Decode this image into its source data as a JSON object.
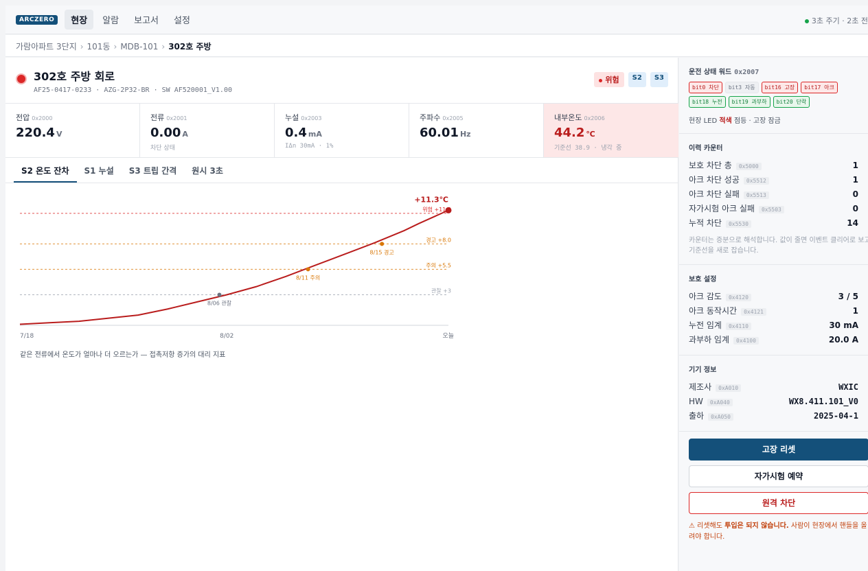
{
  "app": {
    "brand": "ARCZERO",
    "nav": [
      "현장",
      "알람",
      "보고서",
      "설정"
    ],
    "cycle_text": "3초 주기 · 2초 전"
  },
  "breadcrumb": [
    "가람아파트 3단지",
    "101동",
    "MDB-101",
    "302호 주방"
  ],
  "circuit": {
    "title": "302호 주방 회로",
    "subtitle": "AF25-0417-0233 · AZG-2P32-BR · SW AF520001_V1.00",
    "status_badge": "위험",
    "tags": [
      "S2",
      "S3"
    ]
  },
  "metrics": [
    {
      "label": "전압",
      "addr": "0x2000",
      "value": "220.4",
      "unit": "V",
      "note": ""
    },
    {
      "label": "전류",
      "addr": "0x2001",
      "value": "0.00",
      "unit": "A",
      "note": "차단 상태"
    },
    {
      "label": "누설",
      "addr": "0x2003",
      "value": "0.4",
      "unit": "mA",
      "note": "IΔn 30mA · 1%"
    },
    {
      "label": "주파수",
      "addr": "0x2005",
      "value": "60.01",
      "unit": "Hz",
      "note": ""
    },
    {
      "label": "내부온도",
      "addr": "0x2006",
      "value": "44.2",
      "unit": "℃",
      "note": "기준선 38.9 · 냉각 중"
    }
  ],
  "tabs": [
    "S2 온도 잔차",
    "S1 누설",
    "S3 트립 간격",
    "원시 3초"
  ],
  "chart_data": {
    "type": "line",
    "x_ticks": [
      "7/18",
      "8/02",
      "오늘"
    ],
    "x_range": [
      0,
      29
    ],
    "y_range": [
      0,
      12
    ],
    "series": [
      {
        "x": [
          0,
          2,
          4,
          6,
          8,
          10,
          12,
          14,
          16,
          18,
          20,
          22,
          24,
          26,
          27,
          29
        ],
        "y": [
          0.1,
          0.25,
          0.4,
          0.7,
          1.0,
          1.6,
          2.3,
          3.0,
          3.8,
          4.8,
          5.9,
          7.0,
          8.1,
          9.3,
          10.0,
          11.3
        ]
      }
    ],
    "thresholds": [
      {
        "label": "위험 +11.0",
        "value": 11.0,
        "color": "#dc2626"
      },
      {
        "label": "경고 +8.0",
        "value": 8.0,
        "color": "#d97706"
      },
      {
        "label": "주의 +5.5",
        "value": 5.5,
        "color": "#d97706"
      },
      {
        "label": "관찰 +3",
        "value": 3.0,
        "color": "#9ca3af"
      }
    ],
    "annotations": [
      {
        "label": "8/06 관찰",
        "x": 13.5,
        "y": 3.0,
        "color": "#6b7280"
      },
      {
        "label": "8/11 주의",
        "x": 19.5,
        "y": 5.5,
        "color": "#d97706"
      },
      {
        "label": "8/15 경고",
        "x": 24.5,
        "y": 8.0,
        "color": "#d97706"
      }
    ],
    "current_label": "+11.3℃",
    "caption": "같은 전류에서 온도가 얼마나 더 오르는가 — 접촉저항 증가의 대리 지표"
  },
  "status_word": {
    "title": "운전 상태 워드",
    "addr": "0x2007",
    "bits": [
      {
        "label": "bit0 차단",
        "style": "red"
      },
      {
        "label": "bit3 자동",
        "style": "gray"
      },
      {
        "label": "bit16 고장",
        "style": "red"
      },
      {
        "label": "bit17 아크",
        "style": "red"
      },
      {
        "label": "bit18 누전",
        "style": "green"
      },
      {
        "label": "bit19 과부하",
        "style": "green"
      },
      {
        "label": "bit20 단락",
        "style": "green"
      }
    ],
    "led_prefix": "현장 LED",
    "led_color": "적색",
    "led_suffix": "점등 · 고장 잠금"
  },
  "counters": {
    "title": "이력 카운터",
    "rows": [
      {
        "label": "보호 차단 총",
        "addr": "0x5000",
        "value": "1"
      },
      {
        "label": "아크 차단 성공",
        "addr": "0x5512",
        "value": "1"
      },
      {
        "label": "아크 차단 실패",
        "addr": "0x5513",
        "value": "0"
      },
      {
        "label": "자가시험 아크 실패",
        "addr": "0x5503",
        "value": "0"
      },
      {
        "label": "누적 차단",
        "addr": "0x5530",
        "value": "14"
      }
    ],
    "note": "카운터는 증분으로 해석합니다. 값이 줄면 이벤트 클리어로 보고 기준선을 새로 잡습니다."
  },
  "protection": {
    "title": "보호 설정",
    "rows": [
      {
        "label": "아크 감도",
        "addr": "0x4120",
        "value": "3 / 5"
      },
      {
        "label": "아크 동작시간",
        "addr": "0x4121",
        "value": "1"
      },
      {
        "label": "누전 임계",
        "addr": "0x4110",
        "value": "30 mA"
      },
      {
        "label": "과부하 임계",
        "addr": "0x4100",
        "value": "20.0 A"
      }
    ]
  },
  "device": {
    "title": "기기 정보",
    "rows": [
      {
        "label": "제조사",
        "addr": "0xA010",
        "value": "WXIC"
      },
      {
        "label": "HW",
        "addr": "0xA040",
        "value": "WX8.411.101_V0"
      },
      {
        "label": "출하",
        "addr": "0xA050",
        "value": "2025-04-1"
      }
    ]
  },
  "actions": {
    "reset": "고장 리셋",
    "selftest": "자가시험 예약",
    "remote_trip": "원격 차단",
    "warn_prefix": "⚠ 리셋해도",
    "warn_bold": "투입은 되지 않습니다.",
    "warn_rest": "사람이 현장에서 핸들을 올려야 합니다."
  }
}
